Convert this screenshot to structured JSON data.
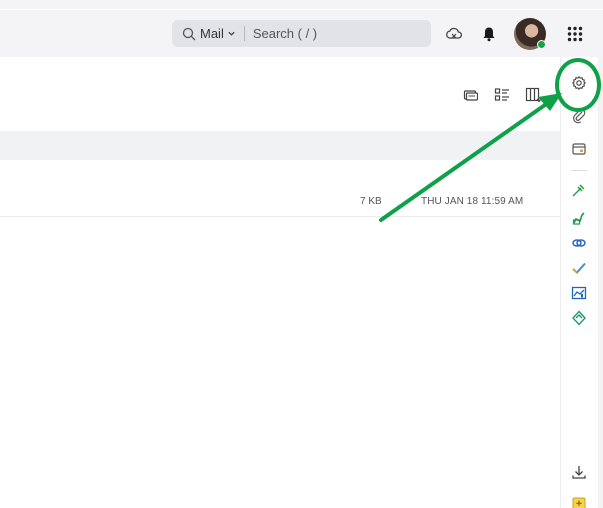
{
  "header": {
    "search_scope": "Mail",
    "search_placeholder": "Search ( / )",
    "icons": [
      "cloud-sync-icon",
      "bell-icon",
      "avatar",
      "app-grid-icon"
    ],
    "presence_color": "#17a34a"
  },
  "toolbar": {
    "icons": [
      "reading-pane-icon",
      "list-view-icon",
      "column-settings-icon"
    ]
  },
  "email_list": {
    "rows": [
      {
        "size": "7 KB",
        "date": "THU JAN 18 11:59 AM"
      }
    ]
  },
  "right_rail": {
    "icons": [
      "gear-icon",
      "attachment-icon",
      "calendar-widget-icon",
      "pin-tool-icon",
      "signature-icon",
      "link-icon",
      "checkmark-icon",
      "chart-icon",
      "diamond-icon",
      "download-icon",
      "note-icon"
    ]
  },
  "annotation": {
    "color": "#0fa14a",
    "target": "settings-gear"
  }
}
